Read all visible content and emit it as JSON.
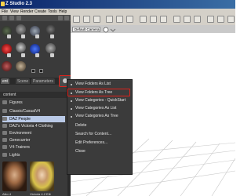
{
  "window": {
    "title": "Z Studio 2.3"
  },
  "menubar": {
    "items": [
      "File",
      "View",
      "Render",
      "Create",
      "Tools",
      "Help"
    ]
  },
  "panel": {
    "tabs": [
      "ent",
      "Scene",
      "Parameters"
    ],
    "content_header": "content",
    "tree": [
      {
        "label": "Figures"
      },
      {
        "label": "Classic/CasualV4"
      },
      {
        "label": "DAZ People",
        "selected": true
      },
      {
        "label": "DAZ's Victoria 4 Clothing"
      },
      {
        "label": "Environment"
      },
      {
        "label": "Genecurrier"
      },
      {
        "label": "V4-Trainers"
      },
      {
        "label": "Lights"
      }
    ],
    "thumbnails": [
      {
        "label": "Aiko 4"
      },
      {
        "label": "Victoria 4.2 Elit"
      }
    ]
  },
  "viewport": {
    "camera": "Default Camera"
  },
  "context_menu": {
    "items": [
      "View Folders As List",
      "View Folders As Tree",
      "View Categories - QuickStart",
      "View Categories As List",
      "View Categories As Tree",
      "Delete",
      "Search for Content...",
      "Edit Preferences...",
      "Close"
    ],
    "highlighted_index": 1
  },
  "colors": {
    "highlight": "#e0221b",
    "panel_bg": "#3a3a3a",
    "selection": "#b9c9e6"
  }
}
